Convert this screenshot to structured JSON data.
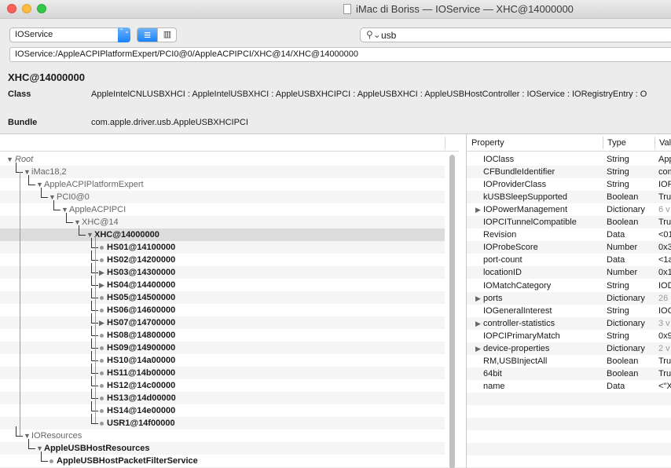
{
  "window": {
    "title": "iMac di Boriss — IOService — XHC@14000000"
  },
  "toolbar": {
    "plane": "IOService",
    "plane_stepper": "⌃⌄",
    "search_value": "usb",
    "list_view_icon": "≣",
    "column_view_icon": "▥"
  },
  "path": "IOService:/AppleACPIPlatformExpert/PCI0@0/AppleACPIPCI/XHC@14/XHC@14000000",
  "info": {
    "name": "XHC@14000000",
    "class_label": "Class",
    "class_value": "AppleIntelCNLUSBXHCI : AppleIntelUSBXHCI : AppleUSBXHCIPCI : AppleUSBXHCI : AppleUSBHostController : IOService : IORegistryEntry : O",
    "bundle_label": "Bundle",
    "bundle_value": "com.apple.driver.usb.AppleUSBXHCIPCI"
  },
  "tree": [
    {
      "label": "Root",
      "style": "i",
      "indent": 0,
      "tri": "▼"
    },
    {
      "label": "iMac18,2",
      "style": "g",
      "indent": 1,
      "tri": "▼"
    },
    {
      "label": "AppleACPIPlatformExpert",
      "style": "g",
      "indent": 2,
      "tri": "▼"
    },
    {
      "label": "PCI0@0",
      "style": "g",
      "indent": 3,
      "tri": "▼"
    },
    {
      "label": "AppleACPIPCI",
      "style": "g",
      "indent": 4,
      "tri": "▼"
    },
    {
      "label": "XHC@14",
      "style": "g",
      "indent": 5,
      "tri": "▼"
    },
    {
      "label": "XHC@14000000",
      "style": "b",
      "indent": 6,
      "tri": "▼",
      "selected": true
    },
    {
      "label": "HS01@14100000",
      "style": "b",
      "indent": 7,
      "tri": ""
    },
    {
      "label": "HS02@14200000",
      "style": "b",
      "indent": 7,
      "tri": ""
    },
    {
      "label": "HS03@14300000",
      "style": "b",
      "indent": 7,
      "tri": "▶"
    },
    {
      "label": "HS04@14400000",
      "style": "b",
      "indent": 7,
      "tri": "▶"
    },
    {
      "label": "HS05@14500000",
      "style": "b",
      "indent": 7,
      "tri": ""
    },
    {
      "label": "HS06@14600000",
      "style": "b",
      "indent": 7,
      "tri": ""
    },
    {
      "label": "HS07@14700000",
      "style": "b",
      "indent": 7,
      "tri": "▶"
    },
    {
      "label": "HS08@14800000",
      "style": "b",
      "indent": 7,
      "tri": ""
    },
    {
      "label": "HS09@14900000",
      "style": "b",
      "indent": 7,
      "tri": ""
    },
    {
      "label": "HS10@14a00000",
      "style": "b",
      "indent": 7,
      "tri": ""
    },
    {
      "label": "HS11@14b00000",
      "style": "b",
      "indent": 7,
      "tri": ""
    },
    {
      "label": "HS12@14c00000",
      "style": "b",
      "indent": 7,
      "tri": ""
    },
    {
      "label": "HS13@14d00000",
      "style": "b",
      "indent": 7,
      "tri": ""
    },
    {
      "label": "HS14@14e00000",
      "style": "b",
      "indent": 7,
      "tri": ""
    },
    {
      "label": "USR1@14f00000",
      "style": "b",
      "indent": 7,
      "tri": ""
    },
    {
      "label": "IOResources",
      "style": "g",
      "indent": 1,
      "tri": "▼"
    },
    {
      "label": "AppleUSBHostResources",
      "style": "b",
      "indent": 2,
      "tri": "▼"
    },
    {
      "label": "AppleUSBHostPacketFilterService",
      "style": "b",
      "indent": 3,
      "tri": ""
    }
  ],
  "props": {
    "headers": [
      "Property",
      "Type",
      "Val"
    ],
    "rows": [
      {
        "p": "IOClass",
        "t": "String",
        "v": "App",
        "exp": false
      },
      {
        "p": "CFBundleIdentifier",
        "t": "String",
        "v": "com",
        "exp": false
      },
      {
        "p": "IOProviderClass",
        "t": "String",
        "v": "IOP",
        "exp": false
      },
      {
        "p": "kUSBSleepSupported",
        "t": "Boolean",
        "v": "Tru",
        "exp": false
      },
      {
        "p": "IOPowerManagement",
        "t": "Dictionary",
        "v": "6 v",
        "exp": true
      },
      {
        "p": "IOPCITunnelCompatible",
        "t": "Boolean",
        "v": "Tru",
        "exp": false
      },
      {
        "p": "Revision",
        "t": "Data",
        "v": "<01",
        "exp": false
      },
      {
        "p": "IOProbeScore",
        "t": "Number",
        "v": "0x3",
        "exp": false
      },
      {
        "p": "port-count",
        "t": "Data",
        "v": "<1a",
        "exp": false
      },
      {
        "p": "locationID",
        "t": "Number",
        "v": "0x1",
        "exp": false
      },
      {
        "p": "IOMatchCategory",
        "t": "String",
        "v": "IOD",
        "exp": false
      },
      {
        "p": "ports",
        "t": "Dictionary",
        "v": "26",
        "exp": true
      },
      {
        "p": "IOGeneralInterest",
        "t": "String",
        "v": "IOC",
        "exp": false
      },
      {
        "p": "controller-statistics",
        "t": "Dictionary",
        "v": "3 v",
        "exp": true
      },
      {
        "p": "IOPCIPrimaryMatch",
        "t": "String",
        "v": "0x9",
        "exp": false
      },
      {
        "p": "device-properties",
        "t": "Dictionary",
        "v": "2 v",
        "exp": true
      },
      {
        "p": "RM,USBInjectAll",
        "t": "Boolean",
        "v": "Tru",
        "exp": false
      },
      {
        "p": "64bit",
        "t": "Boolean",
        "v": "Tru",
        "exp": false
      },
      {
        "p": "name",
        "t": "Data",
        "v": "<\"X",
        "exp": false
      }
    ]
  }
}
